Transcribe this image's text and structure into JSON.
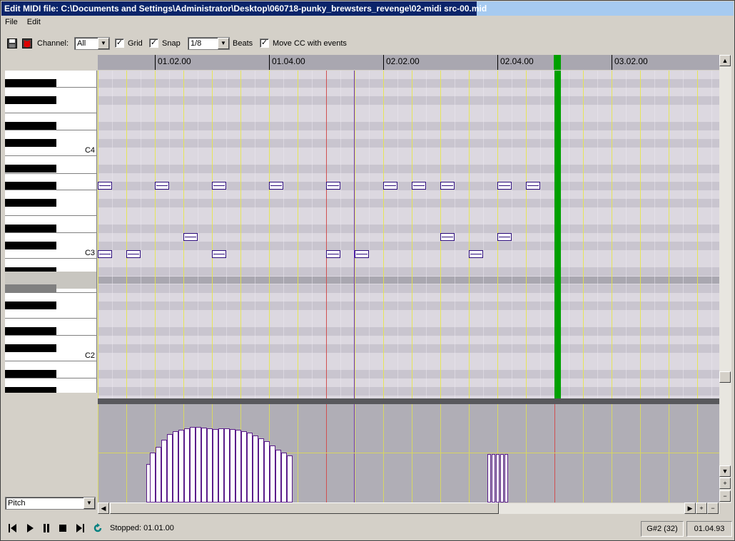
{
  "window": {
    "title": "Edit MIDI file: C:\\Documents and Settings\\Administrator\\Desktop\\060718-punky_brewsters_revenge\\02-midi src-00.mid"
  },
  "menu": {
    "file": "File",
    "edit": "Edit"
  },
  "toolbar": {
    "save_icon": "save-icon",
    "delete_icon": "midi-delete-icon",
    "channel_label": "Channel:",
    "channel_value": "All",
    "grid_label": "Grid",
    "grid_checked": true,
    "snap_label": "Snap",
    "snap_checked": true,
    "snap_value": "1/8",
    "beats_label": "Beats",
    "move_cc_label": "Move CC with events",
    "move_cc_checked": true
  },
  "keyboard": {
    "labels": [
      "C4",
      "C3",
      "C2"
    ]
  },
  "ruler": {
    "labels": [
      "01.02.00",
      "01.04.00",
      "02.02.00",
      "02.04.00",
      "03.02.00"
    ]
  },
  "cc_panel": {
    "selected": "Pitch"
  },
  "transport": {
    "icons": [
      "skip-start-icon",
      "play-icon",
      "pause-icon",
      "stop-icon",
      "skip-end-icon",
      "loop-icon"
    ],
    "status_text": "Stopped: 01.01.00"
  },
  "status": {
    "note": "G#2 (32)",
    "position": "01.04.93"
  },
  "colors": {
    "title_bg": "#0a246a",
    "playhead": "#00a000",
    "cursor": "#6a30c8",
    "note_border": "#2a0a7a",
    "beat_line": "#e8e840",
    "measure_line": "#d05050"
  }
}
